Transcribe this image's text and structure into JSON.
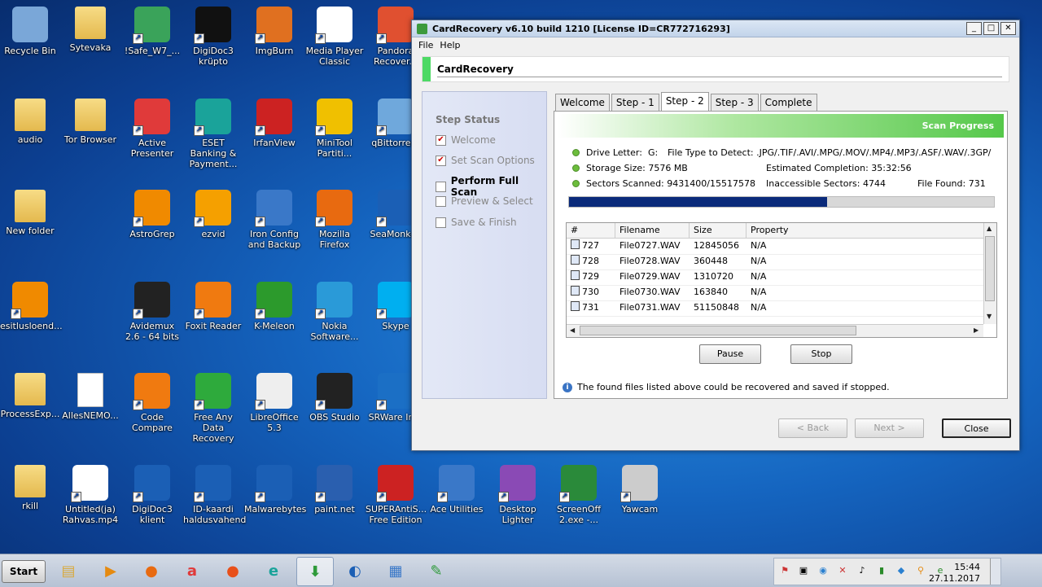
{
  "desktop_icons": [
    {
      "label": "Recycle Bin",
      "icon": "recycle-bin-icon",
      "color": "#7aa7d8"
    },
    {
      "label": "Sytevaka",
      "icon": "folder-icon",
      "color": "#e8c15c"
    },
    {
      "label": "!Safe_W7_...",
      "icon": "puzzle-icon",
      "color": "#3aa35a"
    },
    {
      "label": "DigiDoc3 krüpto",
      "icon": "digidoc-crypto-icon",
      "color": "#111111"
    },
    {
      "label": "ImgBurn",
      "icon": "imgburn-icon",
      "color": "#e07020"
    },
    {
      "label": "Media Player Classic",
      "icon": "mpc-icon",
      "color": "#ffffff"
    },
    {
      "label": "Pandora Recover...",
      "icon": "pandora-icon",
      "color": "#e05030"
    },
    {
      "label": "audio",
      "icon": "folder-icon",
      "color": "#e8c15c"
    },
    {
      "label": "Tor Browser",
      "icon": "folder-icon",
      "color": "#e8c15c"
    },
    {
      "label": "Active Presenter",
      "icon": "activepresenter-icon",
      "color": "#e03a3a"
    },
    {
      "label": "ESET Banking & Payment...",
      "icon": "eset-icon",
      "color": "#1aa39a"
    },
    {
      "label": "IrfanView",
      "icon": "irfanview-icon",
      "color": "#cc2222"
    },
    {
      "label": "MiniTool Partiti...",
      "icon": "minitool-icon",
      "color": "#f0c000"
    },
    {
      "label": "qBittorrent",
      "icon": "qbittorrent-icon",
      "color": "#6fa8dc"
    },
    {
      "label": "New folder",
      "icon": "folder-icon",
      "color": "#e8c15c"
    },
    {
      "label": "AstroGrep",
      "icon": "astrogrep-icon",
      "color": "#f08a00"
    },
    {
      "label": "ezvid",
      "icon": "ezvid-icon",
      "color": "#f5a000"
    },
    {
      "label": "Iron Config and Backup",
      "icon": "iron-icon",
      "color": "#3a78c8"
    },
    {
      "label": "Mozilla Firefox",
      "icon": "firefox-icon",
      "color": "#e86a10"
    },
    {
      "label": "SeaMonkey",
      "icon": "seamonkey-icon",
      "color": "#1b5fb5"
    },
    {
      "label": "esitlusloend...",
      "icon": "vlc-icon",
      "color": "#f08a00"
    },
    {
      "label": "Avidemux 2.6 - 64 bits",
      "icon": "avidemux-icon",
      "color": "#222222"
    },
    {
      "label": "Foxit Reader",
      "icon": "foxit-icon",
      "color": "#f07a10"
    },
    {
      "label": "K-Meleon",
      "icon": "kmeleon-icon",
      "color": "#2c9a2c"
    },
    {
      "label": "Nokia Software...",
      "icon": "nokia-icon",
      "color": "#2a9ad8"
    },
    {
      "label": "Skype",
      "icon": "skype-icon",
      "color": "#00aff0"
    },
    {
      "label": "ProcessExp...",
      "icon": "folder-icon",
      "color": "#e8c15c"
    },
    {
      "label": "AllesNEMO...",
      "icon": "file-icon",
      "color": "#ffffff"
    },
    {
      "label": "Code Compare",
      "icon": "codecompare-icon",
      "color": "#f07a10"
    },
    {
      "label": "Free Any Data Recovery",
      "icon": "recovery-icon",
      "color": "#2eaa3c"
    },
    {
      "label": "LibreOffice 5.3",
      "icon": "libreoffice-icon",
      "color": "#eeeeee"
    },
    {
      "label": "OBS Studio",
      "icon": "obs-icon",
      "color": "#222222"
    },
    {
      "label": "SRWare Iron",
      "icon": "srware-icon",
      "color": "#1b6fc5"
    },
    {
      "label": "rkill",
      "icon": "folder-icon",
      "color": "#e8c15c"
    },
    {
      "label": "Untitled(ja) Rahvas.mp4",
      "icon": "mp4-icon",
      "color": "#ffffff"
    },
    {
      "label": "DigiDoc3 klient",
      "icon": "digidoc-client-icon",
      "color": "#1b5fb5"
    },
    {
      "label": "ID-kaardi haldusvahend",
      "icon": "idcard-icon",
      "color": "#1b5fb5"
    },
    {
      "label": "Malwarebytes",
      "icon": "malwarebytes-icon",
      "color": "#1b5fb5"
    },
    {
      "label": "paint.net",
      "icon": "paintnet-icon",
      "color": "#2a5faf"
    },
    {
      "label": "SUPERAntiS... Free Edition",
      "icon": "superantispyware-icon",
      "color": "#cc2222"
    },
    {
      "label": "Ace Utilities",
      "icon": "ace-utilities-icon",
      "color": "#3a78c8"
    },
    {
      "label": "Desktop Lighter",
      "icon": "desktop-lighter-icon",
      "color": "#8a4ab5"
    },
    {
      "label": "ScreenOff 2.exe -...",
      "icon": "screenoff-icon",
      "color": "#2a8a3a"
    },
    {
      "label": "Yawcam",
      "icon": "yawcam-icon",
      "color": "#cccccc"
    }
  ],
  "window": {
    "title": "CardRecovery v6.10 build 1210  [License ID=CR772716293]",
    "menus": [
      "File",
      "Help"
    ],
    "header_title": "CardRecovery",
    "controls": {
      "minimize": "_",
      "maximize": "□",
      "close": "✕"
    }
  },
  "step_status": {
    "title": "Step Status",
    "steps": [
      {
        "label": "Welcome",
        "checked": true
      },
      {
        "label": "Set Scan Options",
        "checked": true
      },
      {
        "label": "Perform Full Scan",
        "checked": false,
        "active": true
      },
      {
        "label": "Preview & Select",
        "checked": false
      },
      {
        "label": "Save & Finish",
        "checked": false
      }
    ]
  },
  "tabs": [
    "Welcome",
    "Step - 1",
    "Step - 2",
    "Step - 3",
    "Complete"
  ],
  "selected_tab": "Step - 2",
  "scan": {
    "header": "Scan Progress",
    "drive_letter_label": "Drive Letter:",
    "drive_letter": "G:",
    "file_type_label": "File Type to Detect:",
    "file_type": ".JPG/.TIF/.AVI/.MPG/.MOV/.MP4/.MP3/.ASF/.WAV/.3GP/",
    "storage_size_label": "Storage Size:",
    "storage_size": "7576 MB",
    "estimated_completion_label": "Estimated Completion:",
    "estimated_completion": "35:32:56",
    "sectors_scanned_label": "Sectors Scanned:",
    "sectors_scanned": "9431400/15517578",
    "inaccessible_label": "Inaccessible  Sectors:",
    "inaccessible": "4744",
    "file_found_label": "File Found:",
    "file_found": "731",
    "progress_fraction": 0.608
  },
  "file_table": {
    "columns": [
      "#",
      "Filename",
      "Size",
      "Property"
    ],
    "rows": [
      {
        "num": "727",
        "filename": "File0727.WAV",
        "size": "12845056",
        "property": "N/A"
      },
      {
        "num": "728",
        "filename": "File0728.WAV",
        "size": "360448",
        "property": "N/A"
      },
      {
        "num": "729",
        "filename": "File0729.WAV",
        "size": "1310720",
        "property": "N/A"
      },
      {
        "num": "730",
        "filename": "File0730.WAV",
        "size": "163840",
        "property": "N/A"
      },
      {
        "num": "731",
        "filename": "File0731.WAV",
        "size": "51150848",
        "property": "N/A"
      }
    ]
  },
  "buttons": {
    "pause": "Pause",
    "stop": "Stop",
    "back": "< Back",
    "next": "Next >",
    "close": "Close"
  },
  "info_text": "The found files listed above could be recovered and saved if stopped.",
  "taskbar": {
    "start_label": "Start",
    "apps": [
      {
        "icon": "explorer-icon",
        "glyph": "▤",
        "color": "#d9a93a"
      },
      {
        "icon": "media-player-icon",
        "glyph": "▶",
        "color": "#e58a10"
      },
      {
        "icon": "firefox-icon",
        "glyph": "●",
        "color": "#e86a10"
      },
      {
        "icon": "activepresenter-icon",
        "glyph": "a",
        "color": "#e03a3a"
      },
      {
        "icon": "firefox-icon",
        "glyph": "●",
        "color": "#e8501a"
      },
      {
        "icon": "eset-icon",
        "glyph": "e",
        "color": "#1aa39a"
      },
      {
        "icon": "cardrecovery-icon",
        "glyph": "⬇",
        "color": "#2e9a3a",
        "active": true
      },
      {
        "icon": "seamonkey-icon",
        "glyph": "◐",
        "color": "#1b5fb5"
      },
      {
        "icon": "control-panel-icon",
        "glyph": "▦",
        "color": "#3a78c8"
      },
      {
        "icon": "notepad-icon",
        "glyph": "✎",
        "color": "#2e9a3a"
      }
    ],
    "clock_time": "15:44",
    "clock_date": "27.11.2017"
  }
}
